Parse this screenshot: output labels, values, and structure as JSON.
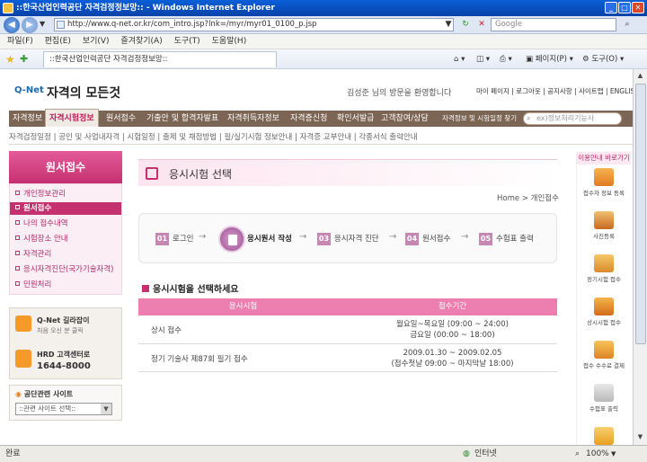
{
  "window": {
    "title": "::한국산업인력공단 자격검정정보망:: - Windows Internet Explorer"
  },
  "addressbar": {
    "url": "http://www.q-net.or.kr/com_intro.jsp?lnk=/myr/myr01_0100_p.jsp",
    "search_placeholder": "Google"
  },
  "menubar": {
    "items": [
      "파일(F)",
      "편집(E)",
      "보기(V)",
      "즐겨찾기(A)",
      "도구(T)",
      "도움말(H)"
    ]
  },
  "favbar": {
    "tab_title": "::한국산업인력공단 자격검정정보망::",
    "page_label": "페이지(P)",
    "tools_label": "도구(O)"
  },
  "site": {
    "logo_mark": "Q-Net",
    "logo_text": "자격의 모든것",
    "welcome": "김성준 님의 방문을 환영합니다",
    "util_links": [
      "마이 페이지",
      "로그아웃",
      "공지사항",
      "사이트맵",
      "ENGLISH"
    ],
    "main_nav": [
      "자격정보",
      "자격시험정보",
      "원서접수",
      "기출안 및 합격자발표",
      "자격취득자정보",
      "자격증신청",
      "확인서발급",
      "고객참여/상담",
      "자격정보 및 시험일정 찾기"
    ],
    "search_placeholder": "ex)정보처리기능사",
    "sub_nav": "자격검정일정 | 공인 및 사업내자격 | 시험일정 | 출제 및 채점방법 | 필/실기시험 정보안내 | 자격증 교부안내 | 각종서식 출력안내"
  },
  "left": {
    "title": "원서접수",
    "items": [
      "개인정보관리",
      "원서접수",
      "나의 접수내역",
      "시험장소 안내",
      "자격관리",
      "응시자격진단(국가기술자격)",
      "민원처리"
    ],
    "qnet_guide_title": "Q-Net 길라잡이",
    "qnet_guide_sub": "처음 오신 분 클릭",
    "hrd_title": "HRD 고객센터로",
    "hrd_phone": "1644-8000",
    "related_title": "공단관련 사이트",
    "related_select": "::관련 사이트 선택::"
  },
  "main": {
    "page_title": "응시시험 선택",
    "breadcrumb": "Home > 개인접수",
    "steps": [
      {
        "num": "01",
        "label": "로그인"
      },
      {
        "num": "",
        "label": "응시원서 작성"
      },
      {
        "num": "03",
        "label": "응시자격 진단"
      },
      {
        "num": "04",
        "label": "원서접수"
      },
      {
        "num": "05",
        "label": "수험표 출력"
      }
    ],
    "section_title": "응시시험을 선택하세요",
    "table": {
      "headers": [
        "응시시험",
        "접수기간"
      ],
      "rows": [
        {
          "exam": "상시 접수",
          "period1": "월요일~목요일 (09:00 ~ 24:00)",
          "period2": "금요일 (00:00 ~ 18:00)"
        },
        {
          "exam": "정기 기술사 제87회 필기 접수",
          "period1": "2009.01.30 ~ 2009.02.05",
          "period2": "(접수첫날 09:00 ~ 마지막날 18:00)"
        }
      ]
    }
  },
  "right": {
    "title": "이용안내 바로가기",
    "items": [
      "접수자 정보 등록",
      "사진등록",
      "정기시험 접수",
      "상시시험 접수",
      "접수 수수료 결제",
      "수험표 출력"
    ]
  },
  "status": {
    "left": "완료",
    "zone": "인터넷",
    "zoom": "100%"
  }
}
